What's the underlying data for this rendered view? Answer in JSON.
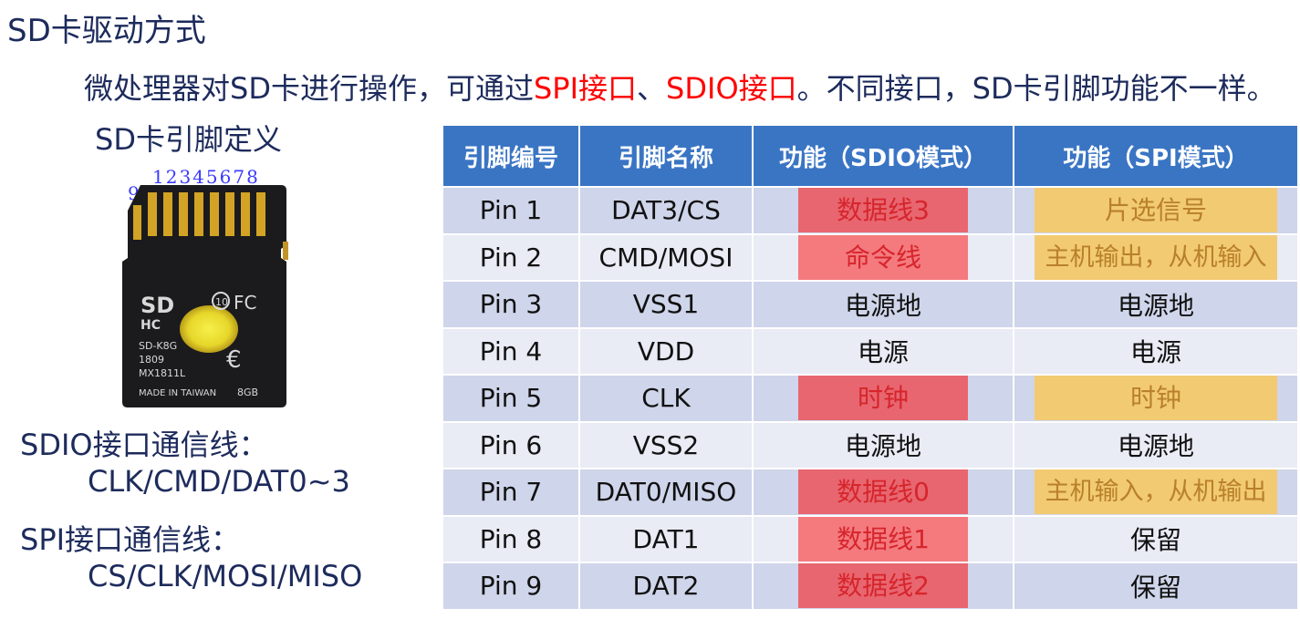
{
  "title": "SD卡驱动方式",
  "intro": {
    "prefix": "微处理器对SD卡进行操作，可通过",
    "spi": "SPI接口",
    "sep": "、",
    "sdio": "SDIO接口",
    "suffix": "。不同接口，SD卡引脚功能不一样。"
  },
  "pin_heading": "SD卡引脚定义",
  "card_pin_labels": {
    "pin9": "9",
    "pins1to8": "12345678"
  },
  "card_print": {
    "model": "SD-K8G",
    "code1": "1809",
    "code2": "MX1811L",
    "origin": "MADE IN TAIWAN",
    "capacity": "8GB"
  },
  "sdio_lines": {
    "label": "SDIO接口通信线：",
    "value": "CLK/CMD/DAT0~3"
  },
  "spi_lines": {
    "label": "SPI接口通信线：",
    "value": "CS/CLK/MOSI/MISO"
  },
  "table": {
    "headers": [
      "引脚编号",
      "引脚名称",
      "功能（SDIO模式）",
      "功能（SPI模式）"
    ],
    "rows": [
      {
        "pin": "Pin 1",
        "name": "DAT3/CS",
        "sdio": "数据线3",
        "spi": "片选信号"
      },
      {
        "pin": "Pin 2",
        "name": "CMD/MOSI",
        "sdio": "命令线",
        "spi": "主机输出，从机输入"
      },
      {
        "pin": "Pin 3",
        "name": "VSS1",
        "sdio": "电源地",
        "spi": "电源地"
      },
      {
        "pin": "Pin 4",
        "name": "VDD",
        "sdio": "电源",
        "spi": "电源"
      },
      {
        "pin": "Pin 5",
        "name": "CLK",
        "sdio": "时钟",
        "spi": "时钟"
      },
      {
        "pin": "Pin 6",
        "name": "VSS2",
        "sdio": "电源地",
        "spi": "电源地"
      },
      {
        "pin": "Pin 7",
        "name": "DAT0/MISO",
        "sdio": "数据线0",
        "spi": "主机输入，从机输出"
      },
      {
        "pin": "Pin 8",
        "name": "DAT1",
        "sdio": "数据线1",
        "spi": "保留"
      },
      {
        "pin": "Pin 9",
        "name": "DAT2",
        "sdio": "数据线2",
        "spi": "保留"
      }
    ]
  },
  "colors": {
    "text": "#1d2b5c",
    "highlight_text": "#ff0000",
    "header_bg": "#3a75c4",
    "row_dark": "#cfd5ea",
    "row_light": "#e9ebf5",
    "sdio_highlight": "#f47a7e",
    "spi_highlight": "#f2ca72"
  }
}
